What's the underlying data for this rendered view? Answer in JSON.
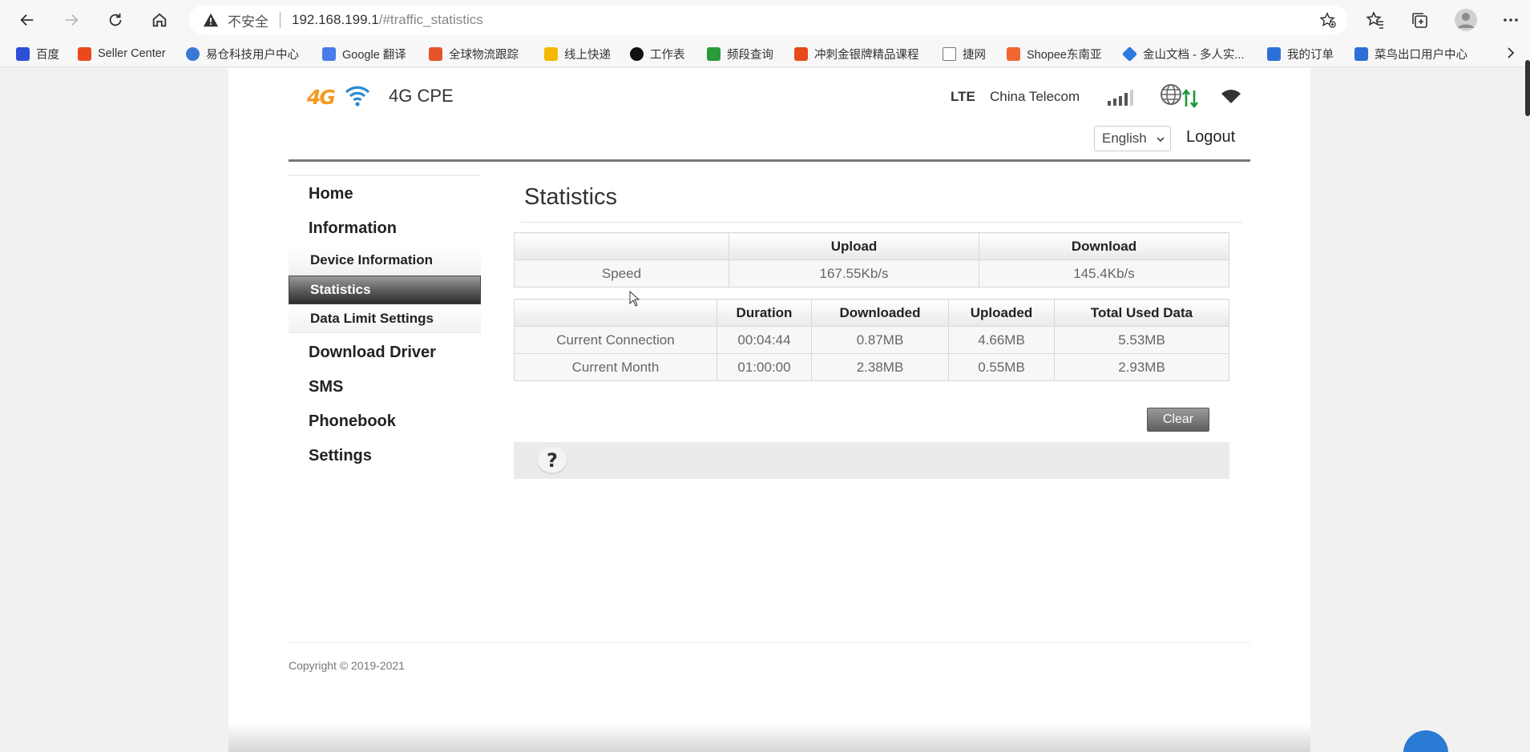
{
  "browser": {
    "security_label": "不安全",
    "url_host": "192.168.199.1",
    "url_path": "/#traffic_statistics",
    "icons": [
      "back-icon",
      "forward-icon",
      "refresh-icon",
      "home-icon",
      "warning-icon",
      "favorite-add-icon",
      "favorites-icon",
      "collections-icon",
      "profile-icon",
      "more-icon"
    ],
    "bookmarks": [
      {
        "label": "百度",
        "color": "#2c4fd8"
      },
      {
        "label": "Seller Center",
        "color": "#e84a1c"
      },
      {
        "label": "易仓科技用户中心",
        "color": "#3a78d8"
      },
      {
        "label": "Google 翻译",
        "color": "#4a7de8"
      },
      {
        "label": "全球物流跟踪",
        "color": "#e5532a"
      },
      {
        "label": "线上快递",
        "color": "#f5b700"
      },
      {
        "label": "工作表",
        "color": "#111111"
      },
      {
        "label": "频段查询",
        "color": "#2a9a3a"
      },
      {
        "label": "冲刺金银牌精品课程",
        "color": "#e84a1c"
      },
      {
        "label": "捷网",
        "color": "#888888"
      },
      {
        "label": "Shopee东南亚",
        "color": "#f0662e"
      },
      {
        "label": "金山文档 - 多人实...",
        "color": "#2d7be0"
      },
      {
        "label": "我的订单",
        "color": "#2d6fd6"
      },
      {
        "label": "菜鸟出口用户中心",
        "color": "#2d6fd6"
      }
    ]
  },
  "header": {
    "logo_text": "4G",
    "product": "4G CPE",
    "network_type": "LTE",
    "carrier": "China Telecom",
    "language": "English",
    "logout": "Logout"
  },
  "menu": {
    "home": "Home",
    "information": "Information",
    "device_information": "Device Information",
    "statistics": "Statistics",
    "data_limit": "Data Limit Settings",
    "download_driver": "Download Driver",
    "sms": "SMS",
    "phonebook": "Phonebook",
    "settings": "Settings"
  },
  "content": {
    "title": "Statistics",
    "speed_table": {
      "headers": [
        "",
        "Upload",
        "Download"
      ],
      "row": {
        "label": "Speed",
        "upload": "167.55Kb/s",
        "download": "145.4Kb/s"
      }
    },
    "usage_table": {
      "headers": [
        "",
        "Duration",
        "Downloaded",
        "Uploaded",
        "Total Used Data"
      ],
      "rows": [
        {
          "label": "Current Connection",
          "duration": "00:04:44",
          "downloaded": "0.87MB",
          "uploaded": "4.66MB",
          "total": "5.53MB"
        },
        {
          "label": "Current Month",
          "duration": "01:00:00",
          "downloaded": "2.38MB",
          "uploaded": "0.55MB",
          "total": "2.93MB"
        }
      ]
    },
    "clear_button": "Clear",
    "help_symbol": "?"
  },
  "footer": {
    "copyright": "Copyright © 2019-2021"
  },
  "colors": {
    "accent_orange": "#f39a1c",
    "wifi_blue": "#2a8ad4",
    "signal_green": "#1d9a3b"
  }
}
